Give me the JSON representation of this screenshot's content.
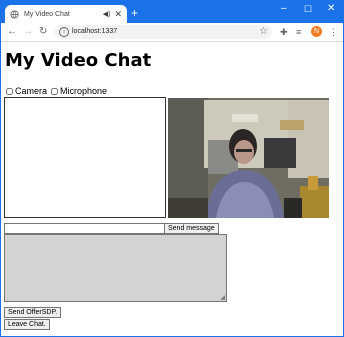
{
  "browser": {
    "tab_title": "My Video Chat",
    "url": "localhost:1337",
    "new_tab_symbol": "+",
    "profile_initial": "N",
    "icons": {
      "favicon": "globe-icon",
      "audio": "speaker-icon",
      "tab_close": "close-icon",
      "back": "arrow-left-icon",
      "forward": "arrow-right-icon",
      "reload": "reload-icon",
      "site_info": "info-icon",
      "bookmark": "star-icon",
      "extensions": "puzzle-icon",
      "media": "media-queue-icon",
      "menu": "kebab-icon"
    },
    "accent_color": "#1a73e8",
    "avatar_color": "#ef7b22"
  },
  "page": {
    "title": "My Video Chat",
    "camera_label": "Camera",
    "microphone_label": "Microphone",
    "camera_checked": false,
    "microphone_checked": false,
    "message_value": "",
    "send_message_label": "Send message",
    "chat_log_text": "",
    "send_offer_label": "Send OfferSDP.",
    "leave_chat_label": "Leave Chat."
  }
}
